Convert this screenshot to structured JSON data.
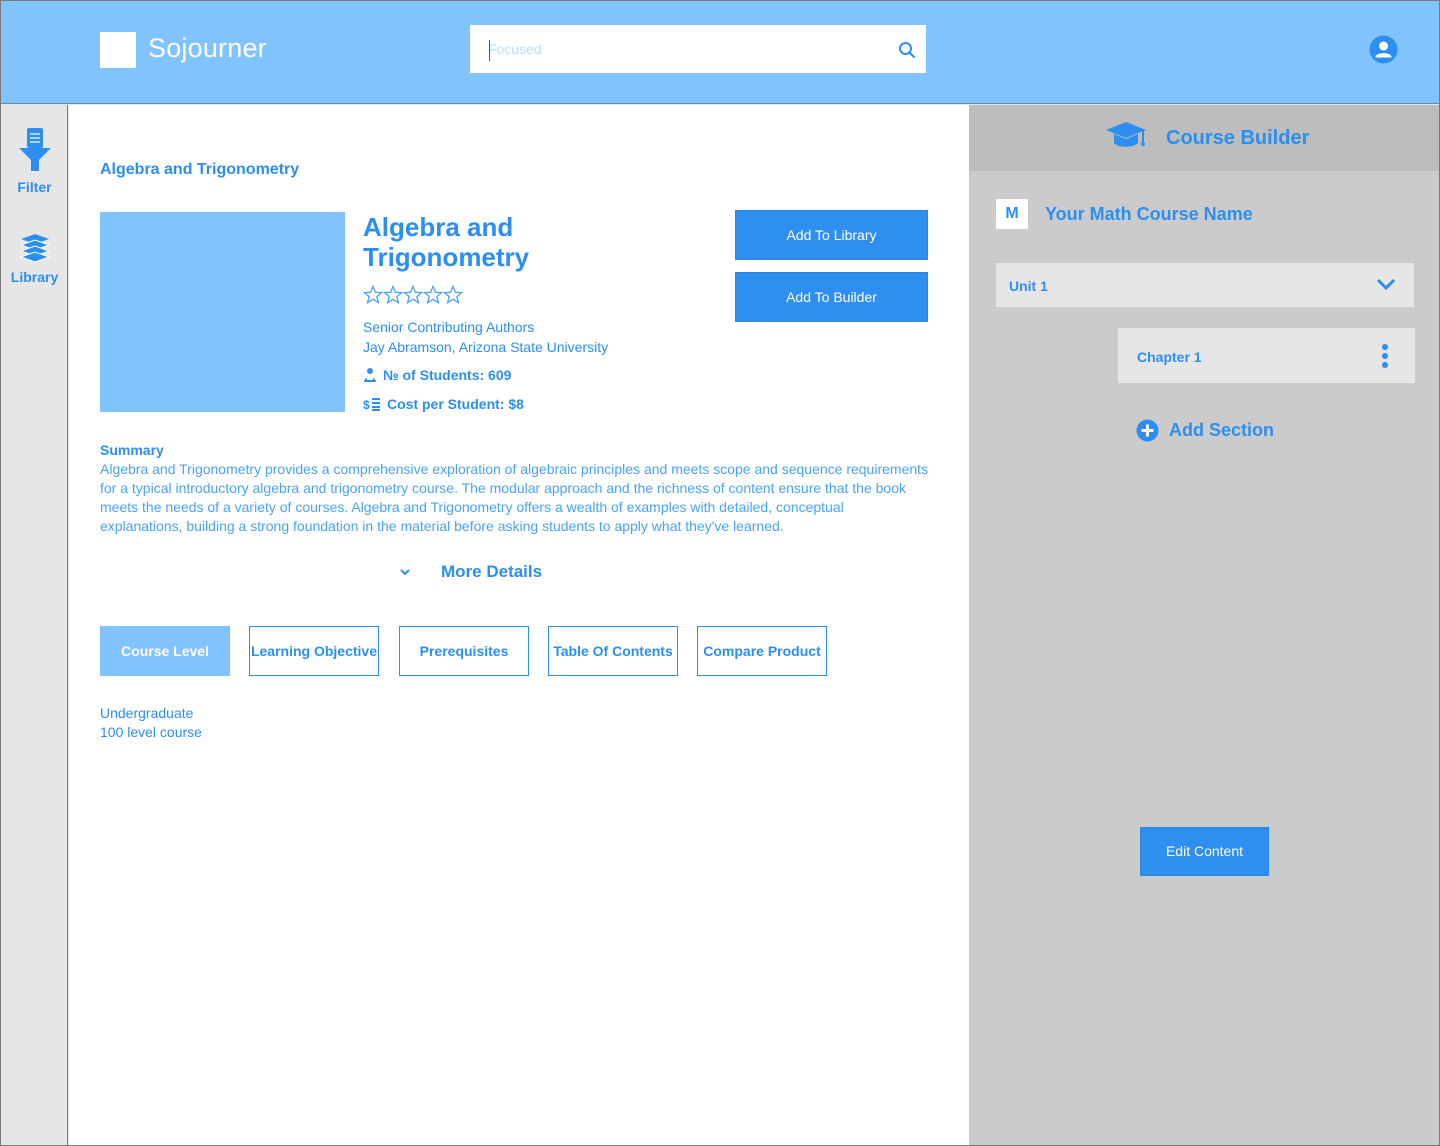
{
  "app": {
    "name": "Sojourner"
  },
  "search": {
    "placeholder": "Focused",
    "value": ""
  },
  "rail": {
    "items": [
      {
        "label": "Filter",
        "icon": "filter-icon"
      },
      {
        "label": "Library",
        "icon": "library-icon"
      }
    ]
  },
  "product": {
    "breadcrumb": "Algebra and Trigonometry",
    "title": "Algebra and Trigonometry",
    "rating": 0,
    "rating_max": 5,
    "authors_label": "Senior Contributing Authors",
    "authors": "Jay Abramson, Arizona State University",
    "students": "№ of Students: 609",
    "cost": "Cost per Student: $8",
    "add_library": "Add To Library",
    "add_builder": "Add To Builder",
    "summary_label": "Summary",
    "summary": "Algebra and Trigonometry provides a comprehensive exploration of algebraic principles and meets scope and sequence requirements for a typical introductory algebra and trigonometry course. The modular approach and the richness of content ensure that the book meets the needs of a variety of courses. Algebra and Trigonometry offers a wealth of examples with detailed, conceptual explanations, building a strong foundation in the material before asking students to apply what they've learned.",
    "more_details": "More Details"
  },
  "tabs": [
    {
      "label": "Course Level",
      "active": true
    },
    {
      "label": "Learning Objective",
      "active": false
    },
    {
      "label": "Prerequisites",
      "active": false
    },
    {
      "label": "Table Of Contents",
      "active": false
    },
    {
      "label": "Compare Product",
      "active": false
    }
  ],
  "course_level": {
    "lines": [
      "Undergraduate",
      "100 level course"
    ]
  },
  "builder": {
    "title": "Course Builder",
    "course_initial": "M",
    "course_name": "Your Math Course Name",
    "unit_label": "Unit 1",
    "chapter_label": "Chapter 1",
    "add_section": "Add Section",
    "edit_content": "Edit Content"
  },
  "colors": {
    "accent": "#2c8ff0",
    "header": "#80c3ff",
    "panel": "#cbcbcb"
  }
}
